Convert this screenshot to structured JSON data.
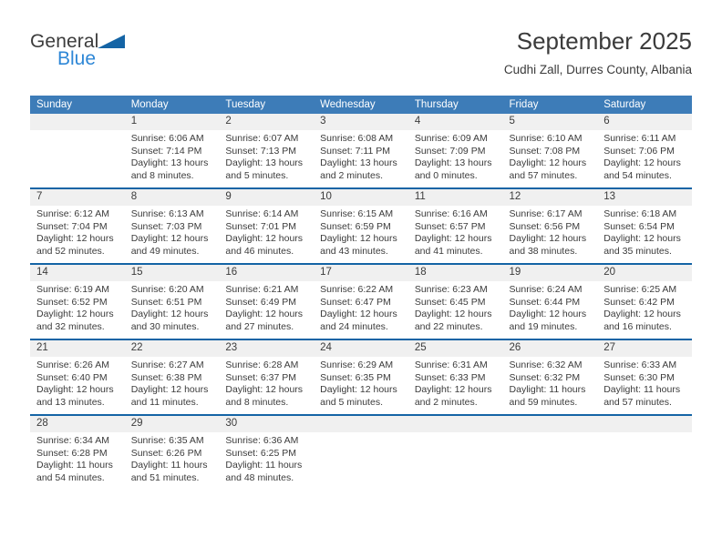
{
  "brand": {
    "name_top": "General",
    "name_bottom": "Blue",
    "triangle_icon": "triangle-icon",
    "accent_blue": "#2e87d6",
    "logo_triangle_color": "#1464a5"
  },
  "header": {
    "title": "September 2025",
    "subtitle": "Cudhi Zall, Durres County, Albania"
  },
  "theme": {
    "header_bg": "#3d7cb8",
    "row_divider": "#1464a5",
    "daynum_bg": "#f0f0f0",
    "text": "#3b3b3b"
  },
  "columns": [
    "Sunday",
    "Monday",
    "Tuesday",
    "Wednesday",
    "Thursday",
    "Friday",
    "Saturday"
  ],
  "weeks": [
    [
      {
        "day": "",
        "lines": []
      },
      {
        "day": "1",
        "lines": [
          "Sunrise: 6:06 AM",
          "Sunset: 7:14 PM",
          "Daylight: 13 hours",
          "and 8 minutes."
        ]
      },
      {
        "day": "2",
        "lines": [
          "Sunrise: 6:07 AM",
          "Sunset: 7:13 PM",
          "Daylight: 13 hours",
          "and 5 minutes."
        ]
      },
      {
        "day": "3",
        "lines": [
          "Sunrise: 6:08 AM",
          "Sunset: 7:11 PM",
          "Daylight: 13 hours",
          "and 2 minutes."
        ]
      },
      {
        "day": "4",
        "lines": [
          "Sunrise: 6:09 AM",
          "Sunset: 7:09 PM",
          "Daylight: 13 hours",
          "and 0 minutes."
        ]
      },
      {
        "day": "5",
        "lines": [
          "Sunrise: 6:10 AM",
          "Sunset: 7:08 PM",
          "Daylight: 12 hours",
          "and 57 minutes."
        ]
      },
      {
        "day": "6",
        "lines": [
          "Sunrise: 6:11 AM",
          "Sunset: 7:06 PM",
          "Daylight: 12 hours",
          "and 54 minutes."
        ]
      }
    ],
    [
      {
        "day": "7",
        "lines": [
          "Sunrise: 6:12 AM",
          "Sunset: 7:04 PM",
          "Daylight: 12 hours",
          "and 52 minutes."
        ]
      },
      {
        "day": "8",
        "lines": [
          "Sunrise: 6:13 AM",
          "Sunset: 7:03 PM",
          "Daylight: 12 hours",
          "and 49 minutes."
        ]
      },
      {
        "day": "9",
        "lines": [
          "Sunrise: 6:14 AM",
          "Sunset: 7:01 PM",
          "Daylight: 12 hours",
          "and 46 minutes."
        ]
      },
      {
        "day": "10",
        "lines": [
          "Sunrise: 6:15 AM",
          "Sunset: 6:59 PM",
          "Daylight: 12 hours",
          "and 43 minutes."
        ]
      },
      {
        "day": "11",
        "lines": [
          "Sunrise: 6:16 AM",
          "Sunset: 6:57 PM",
          "Daylight: 12 hours",
          "and 41 minutes."
        ]
      },
      {
        "day": "12",
        "lines": [
          "Sunrise: 6:17 AM",
          "Sunset: 6:56 PM",
          "Daylight: 12 hours",
          "and 38 minutes."
        ]
      },
      {
        "day": "13",
        "lines": [
          "Sunrise: 6:18 AM",
          "Sunset: 6:54 PM",
          "Daylight: 12 hours",
          "and 35 minutes."
        ]
      }
    ],
    [
      {
        "day": "14",
        "lines": [
          "Sunrise: 6:19 AM",
          "Sunset: 6:52 PM",
          "Daylight: 12 hours",
          "and 32 minutes."
        ]
      },
      {
        "day": "15",
        "lines": [
          "Sunrise: 6:20 AM",
          "Sunset: 6:51 PM",
          "Daylight: 12 hours",
          "and 30 minutes."
        ]
      },
      {
        "day": "16",
        "lines": [
          "Sunrise: 6:21 AM",
          "Sunset: 6:49 PM",
          "Daylight: 12 hours",
          "and 27 minutes."
        ]
      },
      {
        "day": "17",
        "lines": [
          "Sunrise: 6:22 AM",
          "Sunset: 6:47 PM",
          "Daylight: 12 hours",
          "and 24 minutes."
        ]
      },
      {
        "day": "18",
        "lines": [
          "Sunrise: 6:23 AM",
          "Sunset: 6:45 PM",
          "Daylight: 12 hours",
          "and 22 minutes."
        ]
      },
      {
        "day": "19",
        "lines": [
          "Sunrise: 6:24 AM",
          "Sunset: 6:44 PM",
          "Daylight: 12 hours",
          "and 19 minutes."
        ]
      },
      {
        "day": "20",
        "lines": [
          "Sunrise: 6:25 AM",
          "Sunset: 6:42 PM",
          "Daylight: 12 hours",
          "and 16 minutes."
        ]
      }
    ],
    [
      {
        "day": "21",
        "lines": [
          "Sunrise: 6:26 AM",
          "Sunset: 6:40 PM",
          "Daylight: 12 hours",
          "and 13 minutes."
        ]
      },
      {
        "day": "22",
        "lines": [
          "Sunrise: 6:27 AM",
          "Sunset: 6:38 PM",
          "Daylight: 12 hours",
          "and 11 minutes."
        ]
      },
      {
        "day": "23",
        "lines": [
          "Sunrise: 6:28 AM",
          "Sunset: 6:37 PM",
          "Daylight: 12 hours",
          "and 8 minutes."
        ]
      },
      {
        "day": "24",
        "lines": [
          "Sunrise: 6:29 AM",
          "Sunset: 6:35 PM",
          "Daylight: 12 hours",
          "and 5 minutes."
        ]
      },
      {
        "day": "25",
        "lines": [
          "Sunrise: 6:31 AM",
          "Sunset: 6:33 PM",
          "Daylight: 12 hours",
          "and 2 minutes."
        ]
      },
      {
        "day": "26",
        "lines": [
          "Sunrise: 6:32 AM",
          "Sunset: 6:32 PM",
          "Daylight: 11 hours",
          "and 59 minutes."
        ]
      },
      {
        "day": "27",
        "lines": [
          "Sunrise: 6:33 AM",
          "Sunset: 6:30 PM",
          "Daylight: 11 hours",
          "and 57 minutes."
        ]
      }
    ],
    [
      {
        "day": "28",
        "lines": [
          "Sunrise: 6:34 AM",
          "Sunset: 6:28 PM",
          "Daylight: 11 hours",
          "and 54 minutes."
        ]
      },
      {
        "day": "29",
        "lines": [
          "Sunrise: 6:35 AM",
          "Sunset: 6:26 PM",
          "Daylight: 11 hours",
          "and 51 minutes."
        ]
      },
      {
        "day": "30",
        "lines": [
          "Sunrise: 6:36 AM",
          "Sunset: 6:25 PM",
          "Daylight: 11 hours",
          "and 48 minutes."
        ]
      },
      {
        "day": "",
        "lines": []
      },
      {
        "day": "",
        "lines": []
      },
      {
        "day": "",
        "lines": []
      },
      {
        "day": "",
        "lines": []
      }
    ]
  ]
}
